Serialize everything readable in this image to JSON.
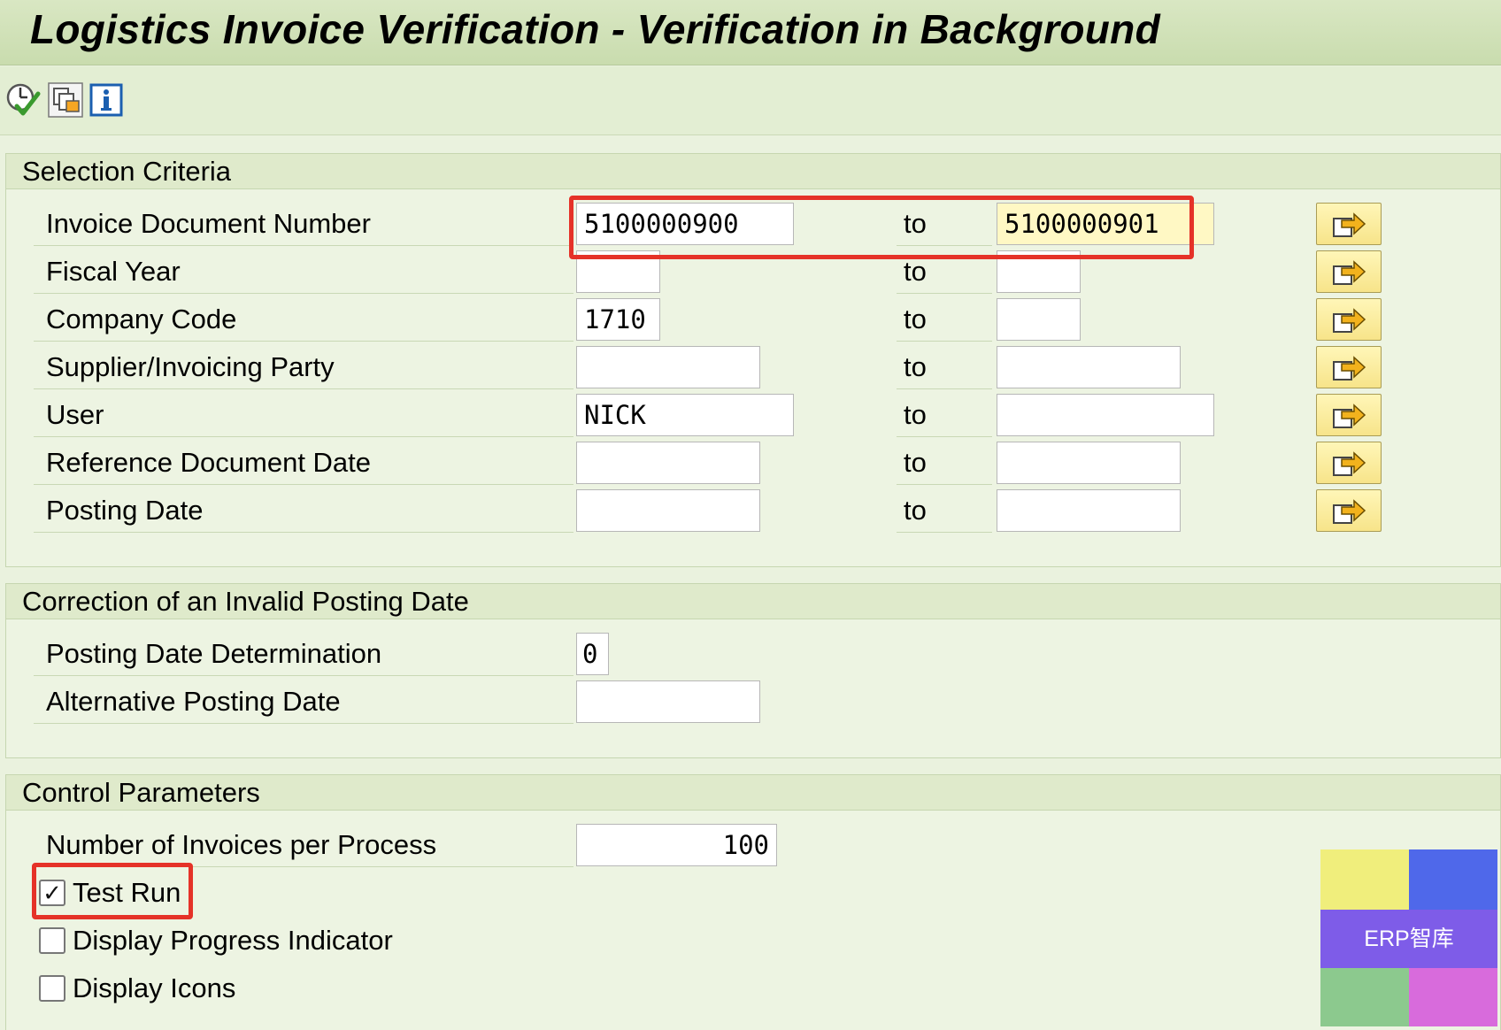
{
  "window": {
    "title": "Logistics Invoice Verification - Verification in Background"
  },
  "toolbar": {
    "icons": [
      "execute-icon",
      "save-variant-icon",
      "info-icon"
    ]
  },
  "selection": {
    "heading": "Selection Criteria",
    "to_label": "to",
    "rows": [
      {
        "label": "Invoice Document Number",
        "from": "5100000900",
        "to": "5100000901"
      },
      {
        "label": "Fiscal Year",
        "from": "",
        "to": ""
      },
      {
        "label": "Company Code",
        "from": "1710",
        "to": ""
      },
      {
        "label": "Supplier/Invoicing Party",
        "from": "",
        "to": ""
      },
      {
        "label": "User",
        "from": "NICK",
        "to": ""
      },
      {
        "label": "Reference Document Date",
        "from": "",
        "to": ""
      },
      {
        "label": "Posting Date",
        "from": "",
        "to": ""
      }
    ]
  },
  "correction": {
    "heading": "Correction of an Invalid Posting Date",
    "rows": [
      {
        "label": "Posting Date Determination",
        "value": "0"
      },
      {
        "label": "Alternative Posting Date",
        "value": ""
      }
    ]
  },
  "control": {
    "heading": "Control Parameters",
    "invoices_per_process": {
      "label": "Number of Invoices per Process",
      "value": "100"
    },
    "checkboxes": [
      {
        "label": "Test Run",
        "checked": true
      },
      {
        "label": "Display Progress Indicator",
        "checked": false
      },
      {
        "label": "Display Icons",
        "checked": false
      }
    ]
  },
  "watermark": {
    "text": "ERP智库"
  },
  "colors": {
    "highlight": "#e53228",
    "field_focus": "#fff8c4"
  }
}
